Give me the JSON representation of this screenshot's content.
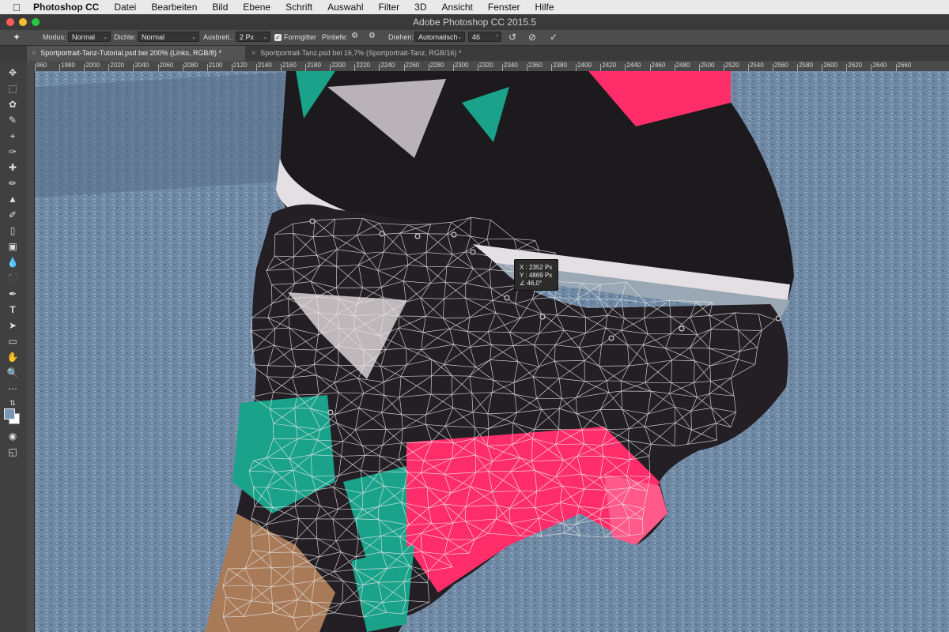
{
  "menubar": {
    "app": "Photoshop CC",
    "items": [
      "Datei",
      "Bearbeiten",
      "Bild",
      "Ebene",
      "Schrift",
      "Auswahl",
      "Filter",
      "3D",
      "Ansicht",
      "Fenster",
      "Hilfe"
    ]
  },
  "window": {
    "title": "Adobe Photoshop CC 2015.5"
  },
  "options": {
    "modus_label": "Modus:",
    "modus_value": "Normal",
    "dichte_label": "Dichte:",
    "dichte_value": "Normal",
    "ausbreit_label": "Ausbreit.:",
    "ausbreit_value": "2 Px",
    "formgitter_label": "Formgitter",
    "pintiefe_label": "Pintiefe:",
    "drehen_label": "Drehen:",
    "drehen_value": "Automatisch",
    "angle_value": "46",
    "angle_unit": "°"
  },
  "tabs": [
    {
      "label": "Sportportrait-Tanz-Tutorial.psd bei 200% (Links, RGB/8) *",
      "active": true
    },
    {
      "label": "Sportportrait-Tanz.psd bei 16,7% (Sportportrait-Tanz, RGB/16) *",
      "active": false
    }
  ],
  "ruler": {
    "labels": [
      "960",
      "1980",
      "2000",
      "2020",
      "2040",
      "2060",
      "2080",
      "2100",
      "2120",
      "2140",
      "2160",
      "2180",
      "2200",
      "2220",
      "2240",
      "2260",
      "2280",
      "2300",
      "2320",
      "2340",
      "2360",
      "2380",
      "2400",
      "2420",
      "2440",
      "2460",
      "2480",
      "2500",
      "2520",
      "2540",
      "2560",
      "2580",
      "2600",
      "2620",
      "2640",
      "2660"
    ]
  },
  "tooltip": {
    "x": "X : 2352 Px",
    "y": "Y : 4869 Px",
    "angle": "46,0°"
  },
  "tools": [
    "move-icon",
    "marquee-icon",
    "lasso-icon",
    "quick-select-icon",
    "crop-icon",
    "eyedropper-icon",
    "healing-icon",
    "brush-icon",
    "stamp-icon",
    "history-brush-icon",
    "eraser-icon",
    "gradient-icon",
    "blur-icon",
    "dodge-icon",
    "pen-icon",
    "type-icon",
    "path-select-icon",
    "shape-icon",
    "hand-icon",
    "zoom-icon",
    "more-icon"
  ],
  "colors": {
    "foreground": "#7b96b3",
    "background": "#ffffff",
    "accent_pink": "#ff2e6a",
    "accent_teal": "#1aa38a"
  }
}
